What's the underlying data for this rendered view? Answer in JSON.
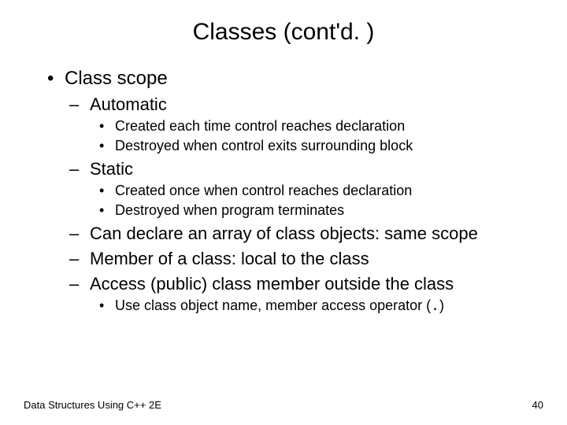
{
  "title": "Classes (cont'd. )",
  "bullets": {
    "b1": "Class scope",
    "b1_1": "Automatic",
    "b1_1_1": "Created each time control reaches declaration",
    "b1_1_2": "Destroyed when control exits surrounding block",
    "b1_2": "Static",
    "b1_2_1": "Created once when control reaches declaration",
    "b1_2_2": "Destroyed when program terminates",
    "b1_3": "Can declare an array of class objects: same scope",
    "b1_4": "Member of a class: local to the class",
    "b1_5": "Access (public) class member outside the class",
    "b1_5_1_pre": "Use class object name, member access operator (",
    "b1_5_1_op": ".",
    "b1_5_1_post": ")"
  },
  "footer": {
    "left": "Data Structures Using C++ 2E",
    "right": "40"
  }
}
